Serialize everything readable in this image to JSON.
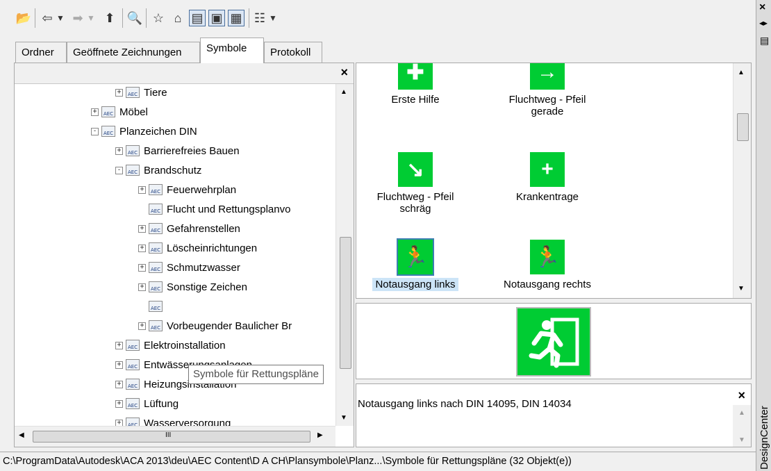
{
  "toolbar": {
    "icons": [
      "load-icon",
      "back-icon",
      "forward-icon",
      "up-icon",
      "search-icon",
      "favorites-icon",
      "home-icon",
      "tree-toggle-icon",
      "preview-toggle-icon",
      "description-toggle-icon",
      "views-icon"
    ]
  },
  "tabs": [
    {
      "label": "Ordner"
    },
    {
      "label": "Geöffnete Zeichnungen"
    },
    {
      "label": "Symbole"
    },
    {
      "label": "Protokoll"
    }
  ],
  "tree": {
    "close": "×",
    "items": [
      {
        "label": "Tiere",
        "level": 2,
        "exp": "+"
      },
      {
        "label": "Möbel",
        "level": 1,
        "exp": "+"
      },
      {
        "label": "Planzeichen DIN",
        "level": 1,
        "exp": "-"
      },
      {
        "label": "Barrierefreies Bauen",
        "level": 2,
        "exp": "+"
      },
      {
        "label": "Brandschutz",
        "level": 2,
        "exp": "-"
      },
      {
        "label": "Feuerwehrplan",
        "level": 3,
        "exp": "+"
      },
      {
        "label": "Flucht und Rettungsplanvo",
        "level": 3,
        "exp": ""
      },
      {
        "label": "Gefahrenstellen",
        "level": 3,
        "exp": "+"
      },
      {
        "label": "Löscheinrichtungen",
        "level": 3,
        "exp": "+"
      },
      {
        "label": "Schmutzwasser",
        "level": 3,
        "exp": "+"
      },
      {
        "label": "Sonstige Zeichen",
        "level": 3,
        "exp": "+"
      },
      {
        "label": "",
        "level": 3,
        "exp": ""
      },
      {
        "label": "Vorbeugender Baulicher Br",
        "level": 3,
        "exp": "+"
      },
      {
        "label": "Elektroinstallation",
        "level": 2,
        "exp": "+"
      },
      {
        "label": "Entwässerungsanlagen",
        "level": 2,
        "exp": "+"
      },
      {
        "label": "Heizungsinstallation",
        "level": 2,
        "exp": "+"
      },
      {
        "label": "Lüftung",
        "level": 2,
        "exp": "+"
      },
      {
        "label": "Wasserversorgung",
        "level": 2,
        "exp": "+"
      }
    ],
    "tooltip": "Symbole für Rettungspläne",
    "hscroll_mark": "III"
  },
  "symbols": [
    {
      "label": "Erste Hilfe",
      "glyph": "✚"
    },
    {
      "label": "Fluchtweg - Pfeil gerade",
      "glyph": "→"
    },
    {
      "label": "Fluchtweg - Pfeil schräg",
      "glyph": "↘"
    },
    {
      "label": "Krankentrage",
      "glyph": "+"
    },
    {
      "label": "Notausgang links",
      "glyph": "🏃"
    },
    {
      "label": "Notausgang rechts",
      "glyph": "🏃"
    }
  ],
  "description": {
    "text": "Notausgang links nach DIN 14095, DIN 14034",
    "close": "×"
  },
  "status": {
    "path": "C:\\ProgramData\\Autodesk\\ACA 2013\\deu\\AEC Content\\D A CH\\Plansymbole\\Planz...\\Symbole für Rettungspläne (32 Objekt(e))"
  },
  "sidebar": {
    "title": "DesignCenter",
    "close": "×"
  },
  "colors": {
    "symbol_green": "#00cc33",
    "selection": "#cce4f7"
  }
}
